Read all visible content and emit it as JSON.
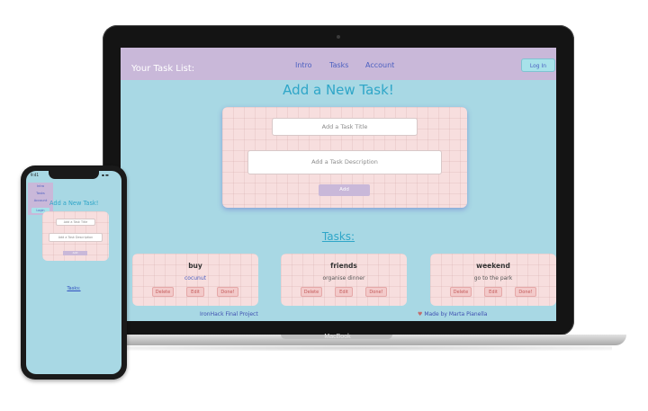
{
  "laptop": {
    "brand": "MacBook",
    "nav": {
      "title": "Your Task List:",
      "links": [
        "Intro",
        "Tasks",
        "Account"
      ],
      "login": "Log In"
    },
    "form": {
      "heading": "Add a New Task!",
      "title_placeholder": "Add a Task Title",
      "description_placeholder": "Add a Task Description",
      "add_label": "Add"
    },
    "tasks_heading": "Tasks:",
    "tasks": [
      {
        "title": "buy",
        "description": "cocunut",
        "buttons": [
          "Delete",
          "Edit",
          "Done!"
        ]
      },
      {
        "title": "friends",
        "description": "organise dinner",
        "buttons": [
          "Delete",
          "Edit",
          "Done!"
        ]
      },
      {
        "title": "weekend",
        "description": "go to the park",
        "buttons": [
          "Delete",
          "Edit",
          "Done!"
        ]
      }
    ],
    "footer": {
      "left": "IronHack Final Project",
      "right": "Made by Marta Pianella"
    }
  },
  "phone": {
    "time": "9:41",
    "status": "▪ ▬",
    "menu": [
      "Intro",
      "Tasks",
      "Account"
    ],
    "login": "Login",
    "heading": "Add a New Task!",
    "title_placeholder": "Add a Task Title",
    "description_placeholder": "Add a Task Description",
    "add_label": "Add",
    "tasks_heading": "Tasks:"
  },
  "colors": {
    "page_bg": "#a8d8e4",
    "nav_bg": "#c9b8d9",
    "accent": "#2fa6c8",
    "card_bg": "#f7dede"
  }
}
